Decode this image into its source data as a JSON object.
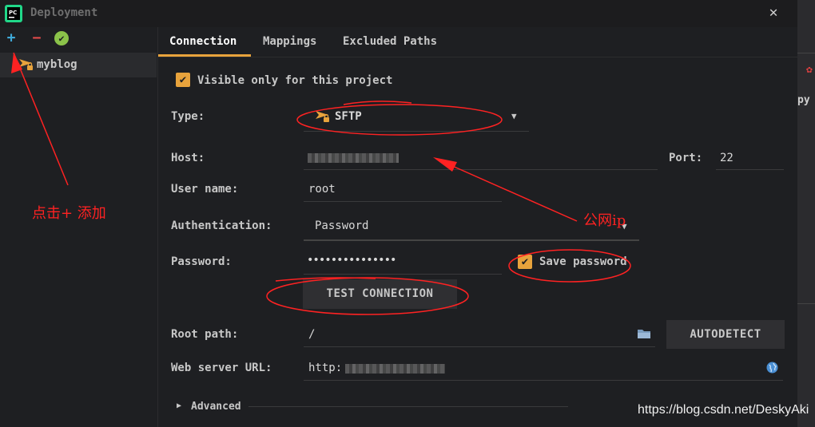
{
  "window": {
    "title": "Deployment",
    "close_label": "✕",
    "app_logo_text": "PC"
  },
  "side_strip": {
    "text": "py",
    "red_glyph": "✿"
  },
  "sidebar": {
    "add_label": "+",
    "remove_label": "−",
    "check_label": "✔",
    "items": [
      {
        "label": "myblog"
      }
    ]
  },
  "tabs": [
    {
      "label": "Connection",
      "active": true
    },
    {
      "label": "Mappings",
      "active": false
    },
    {
      "label": "Excluded Paths",
      "active": false
    }
  ],
  "form": {
    "visible_only_label": "Visible only for this project",
    "check_mark": "✔",
    "type_label": "Type:",
    "type_value": "SFTP",
    "dropdown_arrow": "▼",
    "host_label": "Host:",
    "port_label": "Port:",
    "port_value": "22",
    "user_label": "User name:",
    "user_value": "root",
    "auth_label": "Authentication:",
    "auth_value": "Password",
    "password_label": "Password:",
    "password_value": "•••••••••••••••",
    "save_password_label": "Save password",
    "test_button": "TEST CONNECTION",
    "root_path_label": "Root path:",
    "root_path_value": "/",
    "autodetect_button": "AUTODETECT",
    "web_url_label": "Web server URL:",
    "web_url_value": "http:",
    "advanced_label": "Advanced",
    "advanced_arrow": "▶"
  },
  "annotations": {
    "add_note": "点击+ 添加",
    "ip_note": "公网ip"
  },
  "watermark": "https://blog.csdn.net/DeskyAki",
  "colors": {
    "accent": "#e8a33c",
    "annotation": "#ff2222",
    "background": "#1e1f22"
  }
}
